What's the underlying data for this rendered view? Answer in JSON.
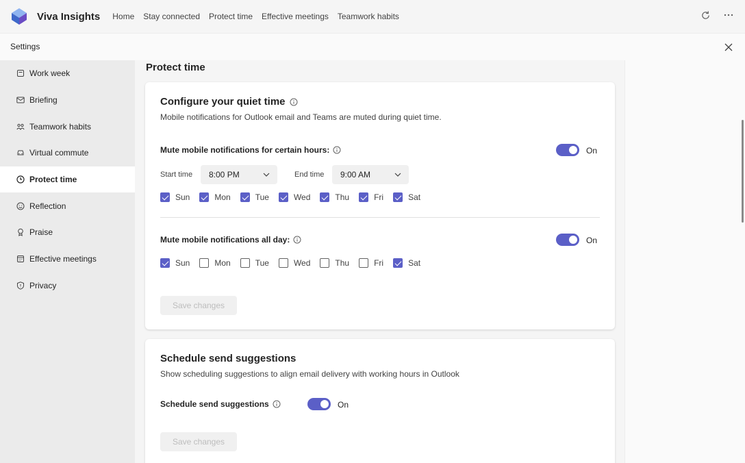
{
  "app": {
    "name": "Viva Insights",
    "nav": [
      "Home",
      "Stay connected",
      "Protect time",
      "Effective meetings",
      "Teamwork habits"
    ]
  },
  "settings_bar": {
    "title": "Settings"
  },
  "sidebar": {
    "items": [
      {
        "label": "Work week",
        "icon": "calendar-icon"
      },
      {
        "label": "Briefing",
        "icon": "mail-icon"
      },
      {
        "label": "Teamwork habits",
        "icon": "people-icon"
      },
      {
        "label": "Virtual commute",
        "icon": "car-icon"
      },
      {
        "label": "Protect time",
        "icon": "clock-icon",
        "active": true
      },
      {
        "label": "Reflection",
        "icon": "smiley-icon"
      },
      {
        "label": "Praise",
        "icon": "ribbon-icon"
      },
      {
        "label": "Effective meetings",
        "icon": "calendar-grid-icon"
      },
      {
        "label": "Privacy",
        "icon": "shield-icon"
      }
    ]
  },
  "main": {
    "heading": "Protect time",
    "quiet_time": {
      "title": "Configure your quiet time",
      "description": "Mobile notifications for Outlook email and Teams are muted during quiet time.",
      "hours": {
        "label": "Mute mobile notifications for certain hours:",
        "toggle": "On",
        "start_label": "Start time",
        "start_value": "8:00 PM",
        "end_label": "End time",
        "end_value": "9:00 AM",
        "days": [
          {
            "label": "Sun",
            "checked": true
          },
          {
            "label": "Mon",
            "checked": true
          },
          {
            "label": "Tue",
            "checked": true
          },
          {
            "label": "Wed",
            "checked": true
          },
          {
            "label": "Thu",
            "checked": true
          },
          {
            "label": "Fri",
            "checked": true
          },
          {
            "label": "Sat",
            "checked": true
          }
        ]
      },
      "all_day": {
        "label": "Mute mobile notifications all day:",
        "toggle": "On",
        "days": [
          {
            "label": "Sun",
            "checked": true
          },
          {
            "label": "Mon",
            "checked": false
          },
          {
            "label": "Tue",
            "checked": false
          },
          {
            "label": "Wed",
            "checked": false
          },
          {
            "label": "Thu",
            "checked": false
          },
          {
            "label": "Fri",
            "checked": false
          },
          {
            "label": "Sat",
            "checked": true
          }
        ]
      },
      "save_label": "Save changes"
    },
    "schedule_send": {
      "title": "Schedule send suggestions",
      "description": "Show scheduling suggestions to align email delivery with working hours in Outlook",
      "label": "Schedule send suggestions",
      "toggle": "On",
      "save_label": "Save changes"
    }
  },
  "colors": {
    "accent": "#5b5fc7",
    "sidebar_bg": "#ebebeb",
    "card_bg": "#ffffff"
  }
}
